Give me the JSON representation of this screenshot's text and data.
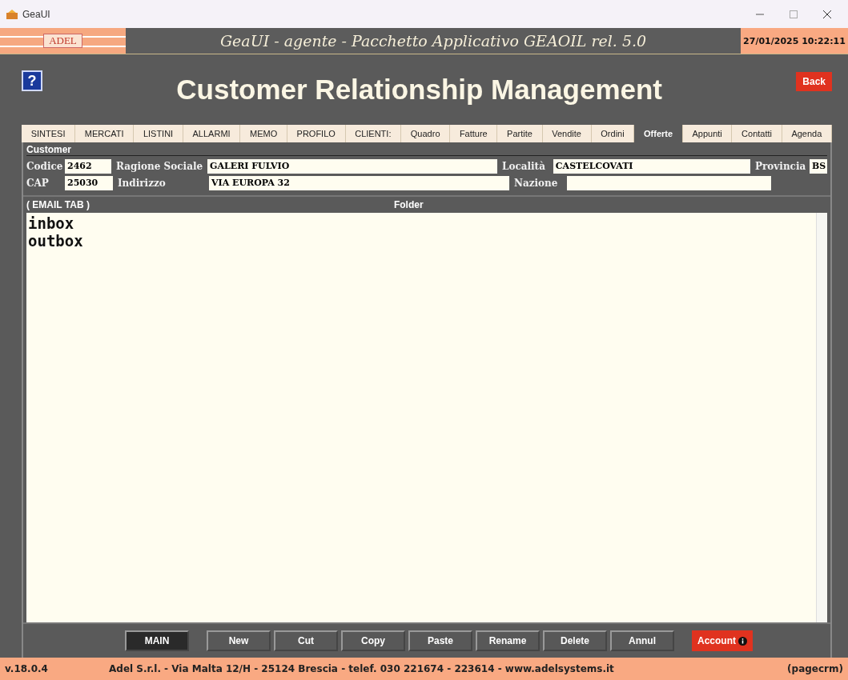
{
  "window": {
    "title": "GeaUI"
  },
  "banner": {
    "logo": "ADEL",
    "title": "GeaUI - agente - Pacchetto Applicativo GEAOIL rel. 5.0",
    "datetime": "27/01/2025 10:22:11"
  },
  "header": {
    "help": "?",
    "title": "Customer Relationship Management",
    "back": "Back"
  },
  "tabs": [
    {
      "label": "SINTESI",
      "selected": false
    },
    {
      "label": "MERCATI",
      "selected": false
    },
    {
      "label": "LISTINI",
      "selected": false
    },
    {
      "label": "ALLARMI",
      "selected": false
    },
    {
      "label": "MEMO",
      "selected": false
    },
    {
      "label": "PROFILO",
      "selected": false
    },
    {
      "label": "CLIENTI:",
      "selected": false
    },
    {
      "label": "Quadro",
      "selected": false
    },
    {
      "label": "Fatture",
      "selected": false
    },
    {
      "label": "Partite",
      "selected": false
    },
    {
      "label": "Vendite",
      "selected": false
    },
    {
      "label": "Ordini",
      "selected": false
    },
    {
      "label": "Offerte",
      "selected": true
    },
    {
      "label": "Appunti",
      "selected": false
    },
    {
      "label": "Contatti",
      "selected": false
    },
    {
      "label": "Agenda",
      "selected": false
    }
  ],
  "customer": {
    "legend": "Customer",
    "rows": [
      [
        {
          "label": "Codice",
          "value": "2462"
        },
        {
          "label": "Ragione Sociale",
          "value": "GALERI FULVIO"
        },
        {
          "label": "Località",
          "value": "CASTELCOVATI"
        },
        {
          "label": "Provincia",
          "value": "BS"
        }
      ],
      [
        {
          "label": "CAP",
          "value": "25030"
        },
        {
          "label": "Indirizzo",
          "value": "VIA EUROPA 32"
        },
        {
          "label": "Nazione"
        }
      ]
    ]
  },
  "email": {
    "label": "( EMAIL TAB )",
    "column": "Folder",
    "folders": [
      "inbox",
      "outbox"
    ]
  },
  "buttons": [
    {
      "label": "MAIN",
      "kind": "main"
    },
    {
      "label": "New",
      "kind": "normal"
    },
    {
      "label": "Cut",
      "kind": "normal"
    },
    {
      "label": "Copy",
      "kind": "normal"
    },
    {
      "label": "Paste",
      "kind": "normal"
    },
    {
      "label": "Rename",
      "kind": "normal"
    },
    {
      "label": "Delete",
      "kind": "normal"
    },
    {
      "label": "Annul",
      "kind": "normal"
    },
    {
      "label": "Account",
      "kind": "account"
    }
  ],
  "status_bar": {
    "version": "v.18.0.4",
    "company": "Adel S.r.l. - Via Malta 12/H - 25124 Brescia - telef. 030 221674 - 223614 - www.adelsystems.it",
    "page": "(pagecrm)"
  }
}
